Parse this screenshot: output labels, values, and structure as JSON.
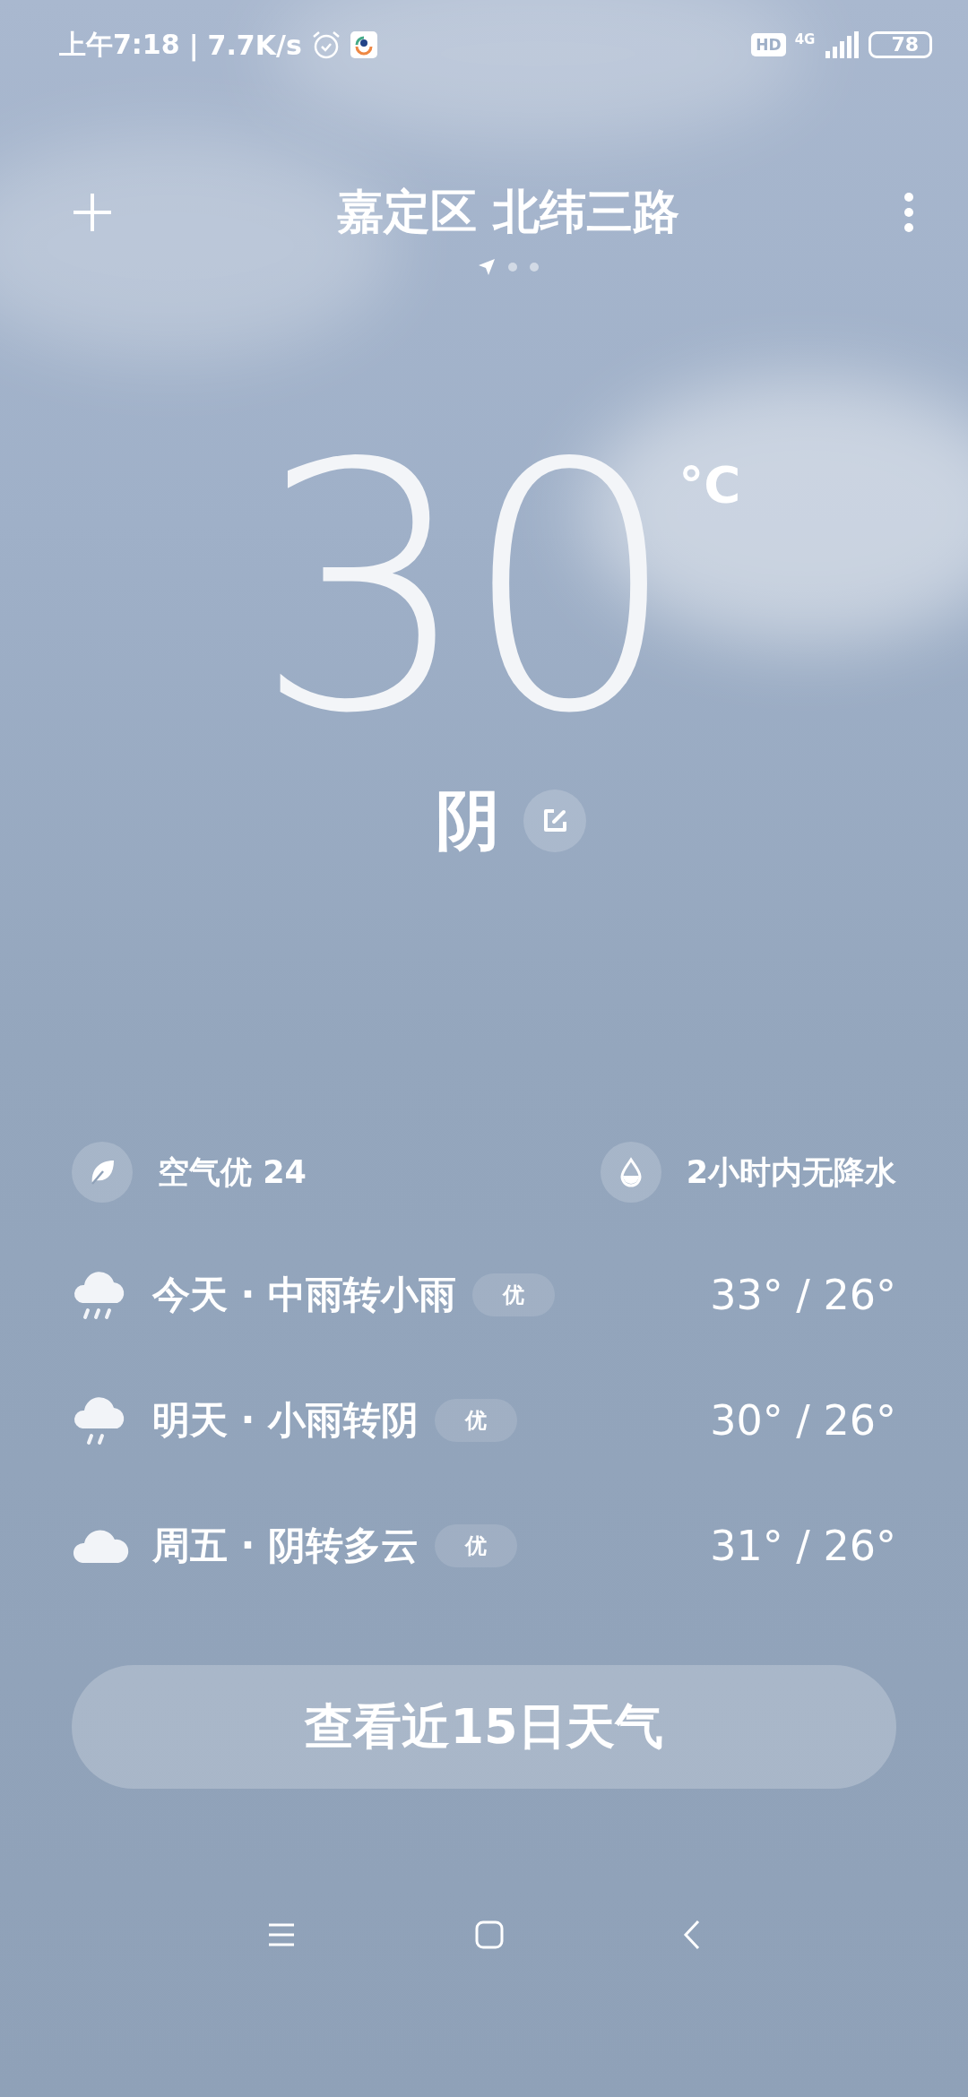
{
  "status_bar": {
    "time": "上午7:18",
    "separator": "|",
    "speed": "7.7K/s",
    "hd": "HD",
    "network": "4G",
    "battery": "78"
  },
  "header": {
    "title": "嘉定区 北纬三路",
    "pages": [
      {
        "kind": "location",
        "selected": true
      },
      {
        "kind": "dot",
        "selected": false
      },
      {
        "kind": "dot",
        "selected": false
      }
    ]
  },
  "current": {
    "temperature": "30",
    "unit": "°C",
    "condition": "阴"
  },
  "stats": [
    {
      "kind": "air",
      "text": "空气优 24"
    },
    {
      "kind": "rain",
      "text": "2小时内无降水"
    }
  ],
  "forecast": [
    {
      "kind": "heavy-rain",
      "label": "今天 · 中雨转小雨",
      "badge": "优",
      "temps": "33° / 26°"
    },
    {
      "kind": "light-rain",
      "label": "明天 · 小雨转阴",
      "badge": "优",
      "temps": "30° / 26°"
    },
    {
      "kind": "cloudy",
      "label": "周五 · 阴转多云",
      "badge": "优",
      "temps": "31° / 26°"
    }
  ],
  "button": "查看近15日天气"
}
